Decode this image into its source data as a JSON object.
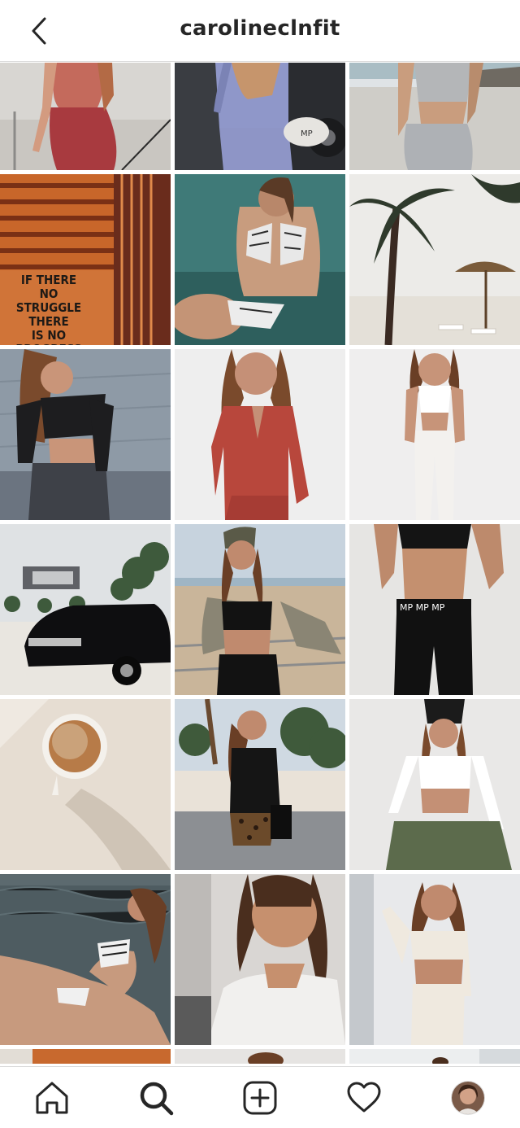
{
  "header": {
    "username": "carolineclnfit",
    "back_icon": "chevron-left-icon"
  },
  "grid": {
    "columns": 3,
    "posts": [
      {
        "row": 1,
        "col": 1,
        "subject": "woman in red top and red leggings on a terrace"
      },
      {
        "row": 1,
        "col": 2,
        "subject": "woman in lavender set holding a cap by a car"
      },
      {
        "row": 1,
        "col": 3,
        "subject": "woman in grey crop top and leggings by the sea"
      },
      {
        "row": 2,
        "col": 1,
        "subject": "orange window blinds with quote",
        "quote": "IF THERE\nNO STRUGGLE\nTHERE\nIS NO\nPROGRESS"
      },
      {
        "row": 2,
        "col": 2,
        "subject": "woman in zebra bikini in the water"
      },
      {
        "row": 2,
        "col": 3,
        "subject": "palm trees and beach umbrellas"
      },
      {
        "row": 3,
        "col": 1,
        "subject": "woman in black crop top against grey wall"
      },
      {
        "row": 3,
        "col": 2,
        "subject": "woman in rust zip top"
      },
      {
        "row": 3,
        "col": 3,
        "subject": "woman in white crop top and joggers"
      },
      {
        "row": 4,
        "col": 1,
        "subject": "black classic car in front of a modern house"
      },
      {
        "row": 4,
        "col": 2,
        "subject": "woman in cap and black set on the beach"
      },
      {
        "row": 4,
        "col": 3,
        "subject": "black sports bra and leggings with waistband logo"
      },
      {
        "row": 5,
        "col": 1,
        "subject": "cup of coffee on a beige surface"
      },
      {
        "row": 5,
        "col": 2,
        "subject": "woman in leopard skirt under palm trees"
      },
      {
        "row": 5,
        "col": 3,
        "subject": "woman in black cap, white top and khaki joggers"
      },
      {
        "row": 6,
        "col": 1,
        "subject": "woman in zebra bikini lying on the beach"
      },
      {
        "row": 6,
        "col": 2,
        "subject": "woman in white off-shoulder top portrait"
      },
      {
        "row": 6,
        "col": 3,
        "subject": "woman in cream knit crop set"
      }
    ]
  },
  "navbar": {
    "items": [
      {
        "name": "home",
        "icon": "home-icon"
      },
      {
        "name": "search",
        "icon": "search-icon",
        "active": true
      },
      {
        "name": "new-post",
        "icon": "add-square-icon"
      },
      {
        "name": "activity",
        "icon": "heart-icon"
      },
      {
        "name": "profile",
        "icon": "avatar"
      }
    ]
  },
  "colors": {
    "text": "#262626",
    "divider": "#dbdbdb",
    "background": "#ffffff"
  }
}
